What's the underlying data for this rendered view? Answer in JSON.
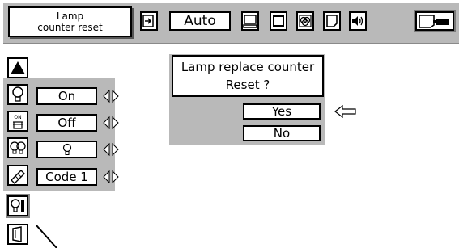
{
  "menu": {
    "title_line1": "Lamp",
    "title_line2": "counter  reset"
  },
  "toolbar": {
    "mode_value": "Auto",
    "icons": [
      "enter-icon",
      "computer-icon",
      "square-icon",
      "color-icon",
      "screen-icon",
      "sound-icon",
      "setting-icon"
    ]
  },
  "side": {
    "items": [
      {
        "icon": "up-arrow-icon",
        "value": ""
      },
      {
        "icon": "lamp-icon",
        "value": "On"
      },
      {
        "icon": "on-indicator-icon",
        "value": "Off"
      },
      {
        "icon": "lamp-mode-icon",
        "value": ""
      },
      {
        "icon": "key-lock-icon",
        "value": "Code 1"
      },
      {
        "icon": "lamp-counter-icon",
        "value": ""
      },
      {
        "icon": "filter-icon",
        "value": ""
      }
    ]
  },
  "dialog": {
    "message_line1": "Lamp replace counter",
    "message_line2": "Reset ?",
    "yes_label": "Yes",
    "no_label": "No"
  },
  "colors": {
    "panel_gray": "#b9b9b9",
    "background": "#ffffff",
    "border": "#000000"
  }
}
